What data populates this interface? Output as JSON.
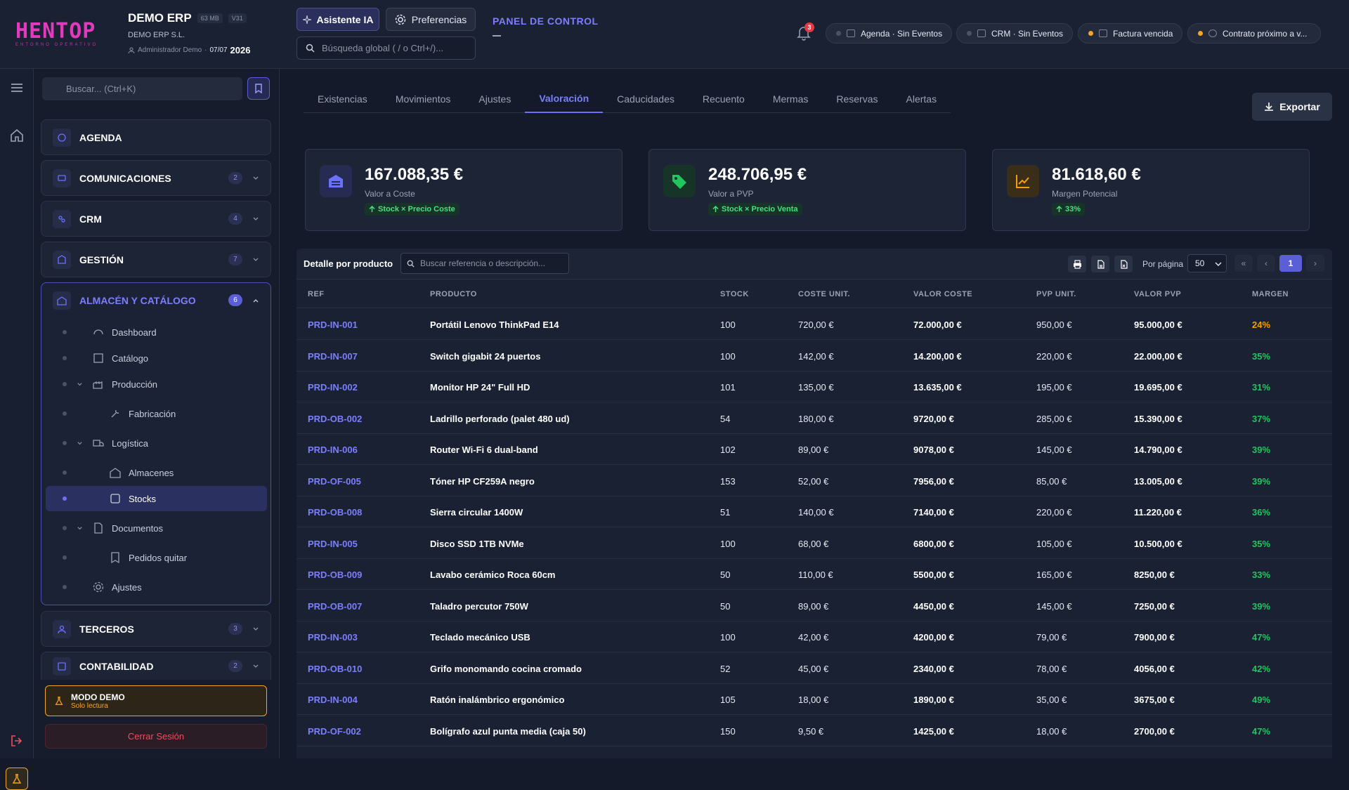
{
  "header": {
    "logo_text": "HENTOP",
    "logo_subtitle": "ENTORNO OPERATIVO",
    "app_title": "DEMO ERP",
    "size_badge": "63 MB",
    "version_badge": "V31",
    "company": "DEMO ERP S.L.",
    "user": "Administrador Demo",
    "date": "07/07",
    "year": "2026",
    "ai_button": "Asistente IA",
    "prefs_button": "Preferencias",
    "search_placeholder": "Búsqueda global ( / o Ctrl+/)...",
    "panel_title": "PANEL DE CONTROL",
    "notifications_count": "3",
    "chips": [
      {
        "label": "Agenda · Sin Eventos",
        "dot": "gray"
      },
      {
        "label": "CRM · Sin Eventos",
        "dot": "gray"
      },
      {
        "label": "Factura vencida",
        "dot": "orange"
      },
      {
        "label": "Contrato próximo a v...",
        "dot": "orange"
      }
    ]
  },
  "sidebar": {
    "search_placeholder": "Buscar... (Ctrl+K)",
    "sections": [
      {
        "label": "AGENDA",
        "badge": ""
      },
      {
        "label": "COMUNICACIONES",
        "badge": "2"
      },
      {
        "label": "CRM",
        "badge": "4"
      },
      {
        "label": "GESTIÓN",
        "badge": "7"
      },
      {
        "label": "ALMACÉN Y CATÁLOGO",
        "badge": "6"
      },
      {
        "label": "TERCEROS",
        "badge": "3"
      },
      {
        "label": "CONTABILIDAD",
        "badge": "2"
      }
    ],
    "sub_items": [
      {
        "label": "Dashboard"
      },
      {
        "label": "Catálogo"
      },
      {
        "label": "Producción"
      },
      {
        "label": "Fabricación"
      },
      {
        "label": "Logística"
      },
      {
        "label": "Almacenes"
      },
      {
        "label": "Stocks"
      },
      {
        "label": "Documentos"
      },
      {
        "label": "Pedidos quitar"
      },
      {
        "label": "Ajustes"
      }
    ],
    "demo_title": "MODO DEMO",
    "demo_subtitle": "Solo lectura",
    "logout": "Cerrar Sesión"
  },
  "main": {
    "tabs": [
      "Existencias",
      "Movimientos",
      "Ajustes",
      "Valoración",
      "Caducidades",
      "Recuento",
      "Mermas",
      "Reservas",
      "Alertas"
    ],
    "active_tab": "Valoración",
    "export_button": "Exportar",
    "cards": [
      {
        "value": "167.088,35 €",
        "label": "Valor a Coste",
        "tag": "Stock × Precio Coste",
        "icon": "warehouse-icon",
        "color": "#6c70ff"
      },
      {
        "value": "248.706,95 €",
        "label": "Valor a PVP",
        "tag": "Stock × Precio Venta",
        "icon": "tag-icon",
        "color": "#22c55e"
      },
      {
        "value": "81.618,60 €",
        "label": "Margen Potencial",
        "tag": "33%",
        "icon": "chart-line-icon",
        "color": "#f59e0b"
      }
    ],
    "table": {
      "title": "Detalle por producto",
      "search_placeholder": "Buscar referencia o descripción...",
      "per_page_label": "Por página",
      "per_page_value": "50",
      "current_page": "1",
      "columns": [
        "REF",
        "PRODUCTO",
        "STOCK",
        "COSTE UNIT.",
        "VALOR COSTE",
        "PVP UNIT.",
        "VALOR PVP",
        "MARGEN"
      ],
      "rows": [
        {
          "ref": "PRD-IN-001",
          "product": "Portátil Lenovo ThinkPad E14",
          "stock": "100",
          "unit_cost": "720,00 €",
          "cost_value": "72.000,00 €",
          "pvp_unit": "950,00 €",
          "pvp_value": "95.000,00 €",
          "margin": "24%",
          "low": true
        },
        {
          "ref": "PRD-IN-007",
          "product": "Switch gigabit 24 puertos",
          "stock": "100",
          "unit_cost": "142,00 €",
          "cost_value": "14.200,00 €",
          "pvp_unit": "220,00 €",
          "pvp_value": "22.000,00 €",
          "margin": "35%",
          "low": false
        },
        {
          "ref": "PRD-IN-002",
          "product": "Monitor HP 24\" Full HD",
          "stock": "101",
          "unit_cost": "135,00 €",
          "cost_value": "13.635,00 €",
          "pvp_unit": "195,00 €",
          "pvp_value": "19.695,00 €",
          "margin": "31%",
          "low": false
        },
        {
          "ref": "PRD-OB-002",
          "product": "Ladrillo perforado (palet 480 ud)",
          "stock": "54",
          "unit_cost": "180,00 €",
          "cost_value": "9720,00 €",
          "pvp_unit": "285,00 €",
          "pvp_value": "15.390,00 €",
          "margin": "37%",
          "low": false
        },
        {
          "ref": "PRD-IN-006",
          "product": "Router Wi-Fi 6 dual-band",
          "stock": "102",
          "unit_cost": "89,00 €",
          "cost_value": "9078,00 €",
          "pvp_unit": "145,00 €",
          "pvp_value": "14.790,00 €",
          "margin": "39%",
          "low": false
        },
        {
          "ref": "PRD-OF-005",
          "product": "Tóner HP CF259A negro",
          "stock": "153",
          "unit_cost": "52,00 €",
          "cost_value": "7956,00 €",
          "pvp_unit": "85,00 €",
          "pvp_value": "13.005,00 €",
          "margin": "39%",
          "low": false
        },
        {
          "ref": "PRD-OB-008",
          "product": "Sierra circular 1400W",
          "stock": "51",
          "unit_cost": "140,00 €",
          "cost_value": "7140,00 €",
          "pvp_unit": "220,00 €",
          "pvp_value": "11.220,00 €",
          "margin": "36%",
          "low": false
        },
        {
          "ref": "PRD-IN-005",
          "product": "Disco SSD 1TB NVMe",
          "stock": "100",
          "unit_cost": "68,00 €",
          "cost_value": "6800,00 €",
          "pvp_unit": "105,00 €",
          "pvp_value": "10.500,00 €",
          "margin": "35%",
          "low": false
        },
        {
          "ref": "PRD-OB-009",
          "product": "Lavabo cerámico Roca 60cm",
          "stock": "50",
          "unit_cost": "110,00 €",
          "cost_value": "5500,00 €",
          "pvp_unit": "165,00 €",
          "pvp_value": "8250,00 €",
          "margin": "33%",
          "low": false
        },
        {
          "ref": "PRD-OB-007",
          "product": "Taladro percutor 750W",
          "stock": "50",
          "unit_cost": "89,00 €",
          "cost_value": "4450,00 €",
          "pvp_unit": "145,00 €",
          "pvp_value": "7250,00 €",
          "margin": "39%",
          "low": false
        },
        {
          "ref": "PRD-IN-003",
          "product": "Teclado mecánico USB",
          "stock": "100",
          "unit_cost": "42,00 €",
          "cost_value": "4200,00 €",
          "pvp_unit": "79,00 €",
          "pvp_value": "7900,00 €",
          "margin": "47%",
          "low": false
        },
        {
          "ref": "PRD-OB-010",
          "product": "Grifo monomando cocina cromado",
          "stock": "52",
          "unit_cost": "45,00 €",
          "cost_value": "2340,00 €",
          "pvp_unit": "78,00 €",
          "pvp_value": "4056,00 €",
          "margin": "42%",
          "low": false
        },
        {
          "ref": "PRD-IN-004",
          "product": "Ratón inalámbrico ergonómico",
          "stock": "105",
          "unit_cost": "18,00 €",
          "cost_value": "1890,00 €",
          "pvp_unit": "35,00 €",
          "pvp_value": "3675,00 €",
          "margin": "49%",
          "low": false
        },
        {
          "ref": "PRD-OF-002",
          "product": "Bolígrafo azul punta media (caja 50)",
          "stock": "150",
          "unit_cost": "9,50 €",
          "cost_value": "1425,00 €",
          "pvp_unit": "18,00 €",
          "pvp_value": "2700,00 €",
          "margin": "47%",
          "low": false
        }
      ]
    }
  }
}
